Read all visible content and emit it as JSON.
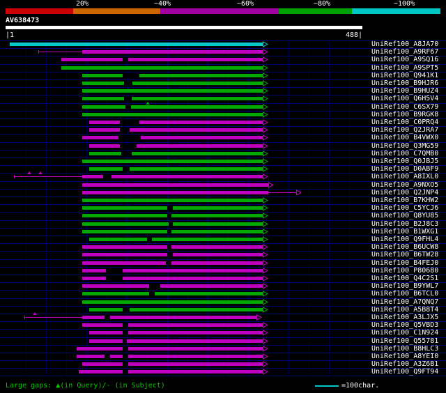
{
  "header": {
    "scale_labels": [
      "20%",
      "~40%",
      "~60%",
      "~80%",
      "~100%"
    ],
    "scale_colors": [
      "#cc0000",
      "#cc6600",
      "#a000a0",
      "#00a000",
      "#00c8c8"
    ],
    "query_name": "AV638473",
    "ruler_start": "|1",
    "ruler_end": "488|"
  },
  "colors": {
    "magenta": "#c000c0",
    "green": "#00a800",
    "cyan": "#00c8c8"
  },
  "footer": {
    "gaps_legend": "Large gaps: ▲(in Query)/- (in Subject)",
    "scale_legend": "=100char.",
    "legend_color": "#00c8c8"
  },
  "chart_data": {
    "type": "bar",
    "subtype": "blast-alignment-spans",
    "title": "AV638473",
    "axis": {
      "min": 1,
      "max": 488
    },
    "legend": {
      "identity_bins": [
        "20%",
        "~40%",
        "~60%",
        "~80%",
        "~100%"
      ],
      "bin_colors": [
        "#cc0000",
        "#cc6600",
        "#a000a0",
        "#00a000",
        "#00c8c8"
      ]
    },
    "rows": [
      {
        "label": "UniRef100_A8JA70",
        "color": "cyan",
        "start": 6,
        "end": 352
      },
      {
        "label": "UniRef100_A9RF67",
        "color": "magenta",
        "line": 45,
        "start": 105,
        "end": 352
      },
      {
        "label": "UniRef100_A9SQ16",
        "color": "magenta",
        "start": 76,
        "end": 352,
        "gaps": [
          [
            160,
            168
          ]
        ]
      },
      {
        "label": "UniRef100_A9SPT5",
        "color": "green",
        "start": 76,
        "end": 352
      },
      {
        "label": "UniRef100_Q941K1",
        "color": "green",
        "start": 105,
        "end": 352,
        "gaps": [
          [
            160,
            183
          ]
        ]
      },
      {
        "label": "UniRef100_B9HJR6",
        "color": "green",
        "start": 105,
        "end": 352,
        "gaps": [
          [
            162,
            173
          ]
        ]
      },
      {
        "label": "UniRef100_B9HUZ4",
        "color": "green",
        "start": 105,
        "end": 352
      },
      {
        "label": "UniRef100_Q6H5V4",
        "color": "green",
        "start": 105,
        "end": 352,
        "gaps": [
          [
            162,
            172
          ]
        ]
      },
      {
        "label": "UniRef100_C6SX79",
        "color": "green",
        "start": 105,
        "end": 352,
        "gaps": [
          [
            164,
            172
          ]
        ],
        "tris": [
          194
        ]
      },
      {
        "label": "UniRef100_B9RGK8",
        "color": "green",
        "start": 105,
        "end": 352
      },
      {
        "label": "UniRef100_C0PRQ4",
        "color": "magenta",
        "start": 114,
        "end": 352,
        "gaps": [
          [
            156,
            183
          ]
        ]
      },
      {
        "label": "UniRef100_Q2JRA7",
        "color": "magenta",
        "start": 114,
        "end": 352,
        "gaps": [
          [
            156,
            170
          ]
        ]
      },
      {
        "label": "UniRef100_B4VWX0",
        "color": "magenta",
        "start": 105,
        "end": 352,
        "gaps": [
          [
            154,
            185
          ]
        ]
      },
      {
        "label": "UniRef100_Q3MG59",
        "color": "magenta",
        "start": 114,
        "end": 352,
        "gaps": [
          [
            156,
            179
          ]
        ]
      },
      {
        "label": "UniRef100_C7QMB0",
        "color": "green",
        "start": 114,
        "end": 352,
        "gaps": [
          [
            158,
            173
          ]
        ]
      },
      {
        "label": "UniRef100_Q0JBJ5",
        "color": "green",
        "start": 105,
        "end": 352
      },
      {
        "label": "UniRef100_D0ABF9",
        "color": "green",
        "start": 114,
        "end": 352,
        "gaps": [
          [
            160,
            170
          ]
        ]
      },
      {
        "label": "UniRef100_A8IXL0",
        "color": "magenta",
        "line": 11,
        "start": 105,
        "end": 352,
        "gaps": [
          [
            133,
            145
          ]
        ],
        "tris": [
          32,
          48
        ]
      },
      {
        "label": "UniRef100_A9NXO5",
        "color": "magenta",
        "start": 105,
        "end": 359
      },
      {
        "label": "UniRef100_Q2JNP4",
        "color": "magenta",
        "start": 105,
        "end": 359,
        "tail": 397
      },
      {
        "label": "UniRef100_B7KHW2",
        "color": "green",
        "start": 105,
        "end": 352
      },
      {
        "label": "UniRef100_C5YCJ6",
        "color": "green",
        "start": 105,
        "end": 352,
        "gaps": [
          [
            221,
            229
          ]
        ]
      },
      {
        "label": "UniRef100_Q8YU85",
        "color": "green",
        "start": 105,
        "end": 352,
        "gaps": [
          [
            221,
            227
          ]
        ]
      },
      {
        "label": "UniRef100_B2J8C3",
        "color": "green",
        "start": 105,
        "end": 352,
        "gaps": [
          [
            223,
            229
          ]
        ]
      },
      {
        "label": "UniRef100_B1WXG1",
        "color": "green",
        "start": 105,
        "end": 352,
        "gaps": [
          [
            221,
            227
          ]
        ]
      },
      {
        "label": "UniRef100_Q9FHL4",
        "color": "green",
        "start": 114,
        "end": 352,
        "gaps": [
          [
            193,
            200
          ]
        ]
      },
      {
        "label": "UniRef100_B6UCW8",
        "color": "magenta",
        "start": 105,
        "end": 352,
        "gaps": [
          [
            221,
            227
          ]
        ]
      },
      {
        "label": "UniRef100_B6TW28",
        "color": "magenta",
        "start": 105,
        "end": 352,
        "gaps": [
          [
            221,
            229
          ]
        ]
      },
      {
        "label": "UniRef100_B4FEJ0",
        "color": "magenta",
        "start": 105,
        "end": 352,
        "gaps": [
          [
            219,
            227
          ]
        ]
      },
      {
        "label": "UniRef100_P80680",
        "color": "magenta",
        "start": 105,
        "end": 352,
        "gaps": [
          [
            137,
            160
          ]
        ]
      },
      {
        "label": "UniRef100_Q4C2S1",
        "color": "magenta",
        "start": 105,
        "end": 352,
        "gaps": [
          [
            137,
            160
          ]
        ]
      },
      {
        "label": "UniRef100_B9YWL7",
        "color": "magenta",
        "start": 105,
        "end": 352,
        "gaps": [
          [
            196,
            212
          ]
        ]
      },
      {
        "label": "UniRef100_B6TCL0",
        "color": "green",
        "start": 105,
        "end": 352,
        "gaps": [
          [
            196,
            204
          ]
        ]
      },
      {
        "label": "UniRef100_A7QNQ7",
        "color": "green",
        "start": 105,
        "end": 352
      },
      {
        "label": "UniRef100_A5B8T4",
        "color": "green",
        "start": 114,
        "end": 352,
        "gaps": [
          [
            160,
            170
          ]
        ]
      },
      {
        "label": "UniRef100_A3LJX5",
        "color": "magenta",
        "line": 26,
        "start": 105,
        "end": 343,
        "gaps": [
          [
            135,
            143
          ]
        ],
        "tris": [
          40
        ]
      },
      {
        "label": "UniRef100_Q5VBD3",
        "color": "magenta",
        "start": 105,
        "end": 352,
        "gaps": [
          [
            160,
            168
          ]
        ]
      },
      {
        "label": "UniRef100_C1N924",
        "color": "magenta",
        "start": 114,
        "end": 352,
        "gaps": [
          [
            160,
            168
          ]
        ]
      },
      {
        "label": "UniRef100_Q55781",
        "color": "magenta",
        "start": 114,
        "end": 352,
        "gaps": [
          [
            160,
            166
          ]
        ]
      },
      {
        "label": "UniRef100_B8HLC3",
        "color": "magenta",
        "start": 97,
        "end": 352,
        "gaps": [
          [
            160,
            168
          ]
        ]
      },
      {
        "label": "UniRef100_A8YEI0",
        "color": "magenta",
        "start": 97,
        "end": 352,
        "gaps": [
          [
            135,
            143
          ],
          [
            160,
            168
          ]
        ]
      },
      {
        "label": "UniRef100_A3Z6B1",
        "color": "magenta",
        "start": 105,
        "end": 352,
        "gaps": [
          [
            160,
            168
          ]
        ]
      },
      {
        "label": "UniRef100_Q9FT94",
        "color": "magenta",
        "start": 100,
        "end": 352,
        "gaps": [
          [
            160,
            168
          ]
        ]
      }
    ]
  }
}
